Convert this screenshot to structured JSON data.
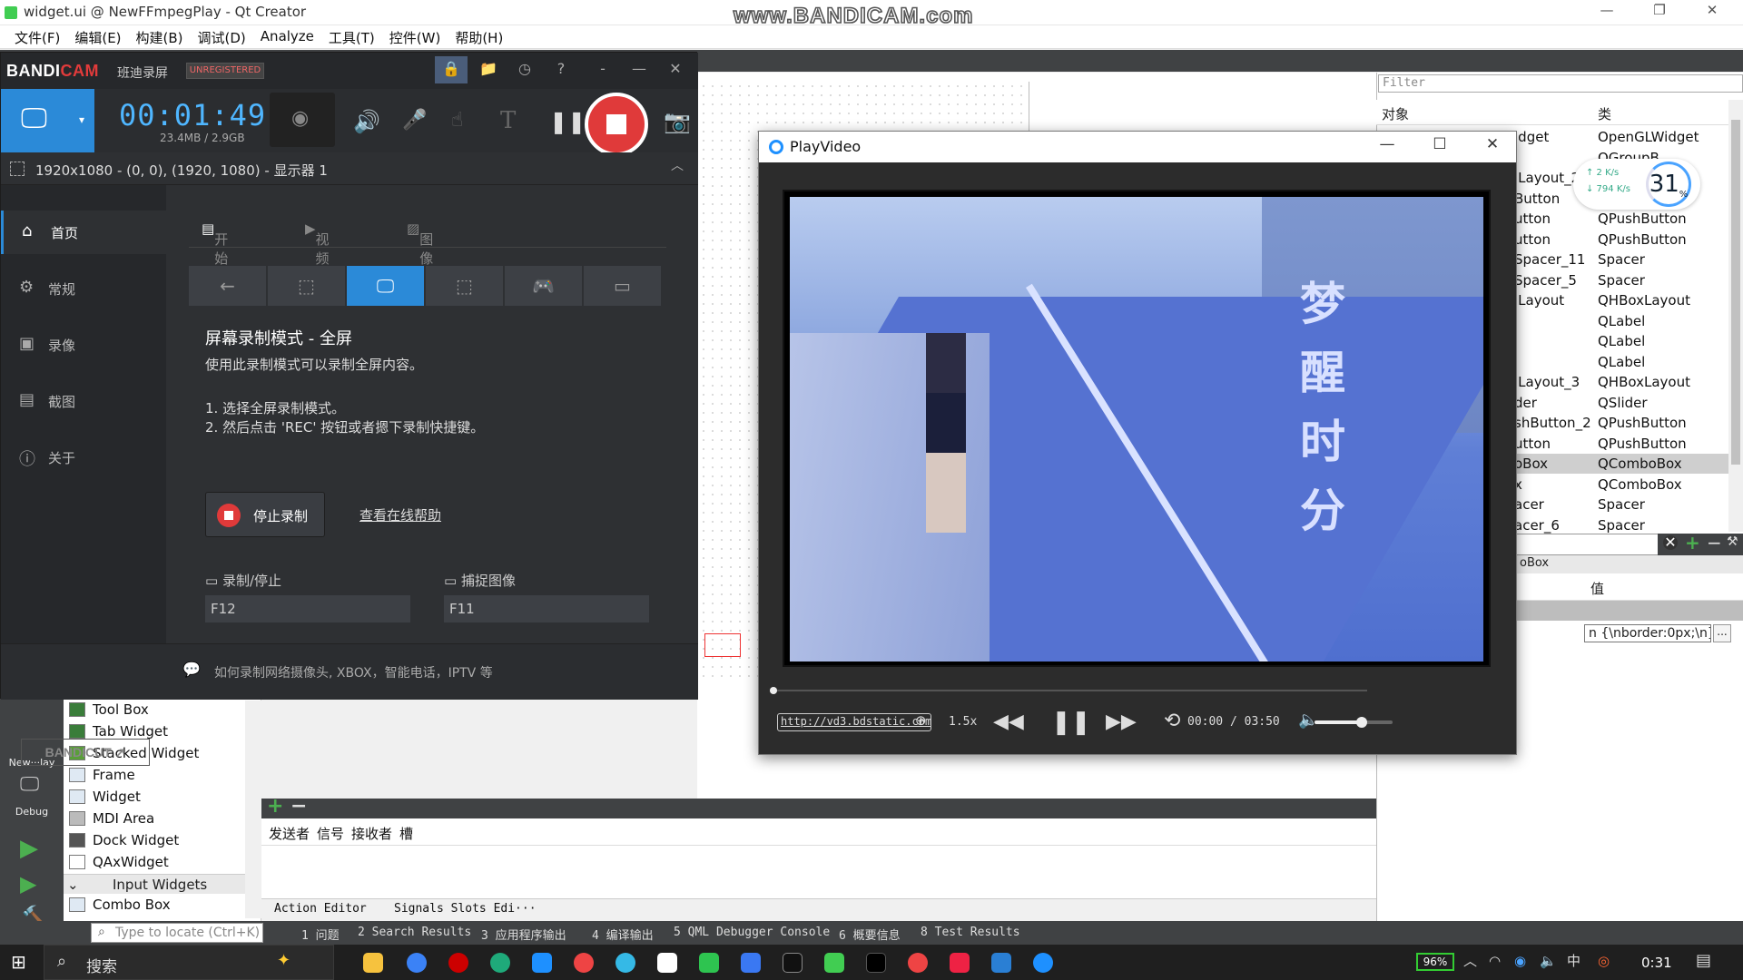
{
  "qt": {
    "title": "widget.ui @ NewFFmpegPlay - Qt Creator",
    "watermark": "www.BANDICAM.com",
    "menu": [
      "文件(F)",
      "编辑(E)",
      "构建(B)",
      "调试(D)",
      "Analyze",
      "工具(T)",
      "控件(W)",
      "帮助(H)"
    ],
    "mode_bar": {
      "project": "New···lay",
      "kit": "Debug"
    },
    "widget_box": {
      "items": [
        "Tool Box",
        "Tab Widget",
        "Stacked Widget",
        "Frame",
        "Widget",
        "MDI Area",
        "Dock Widget",
        "QAxWidget"
      ],
      "category": "Input Widgets",
      "after_category": "Combo Box"
    },
    "signal_slot": {
      "headers": [
        "发送者",
        "信号",
        "接收者",
        "槽"
      ],
      "tabs": [
        "Action Editor",
        "Signals Slots Edi···"
      ]
    },
    "output": {
      "locate_placeholder": "Type to locate (Ctrl+K)",
      "tabs": [
        "1 问题",
        "2 Search Results",
        "3 应用程序输出",
        "4 编译输出",
        "5 QML Debugger Console",
        "6 概要信息",
        "8 Test Results"
      ]
    },
    "object_inspector": {
      "filter_placeholder": "Filter",
      "col_object": "对象",
      "col_class": "类",
      "rows": [
        {
          "name": "idget",
          "cls": "OpenGLWidget"
        },
        {
          "name": "",
          "cls": "QGroupB"
        },
        {
          "name": "lLayout_2",
          "cls": "ut"
        },
        {
          "name": "Button",
          "cls": ""
        },
        {
          "name": "utton",
          "cls": "QPushButton"
        },
        {
          "name": "utton",
          "cls": "QPushButton"
        },
        {
          "name": "Spacer_11",
          "cls": "Spacer"
        },
        {
          "name": "Spacer_5",
          "cls": "Spacer"
        },
        {
          "name": "lLayout",
          "cls": "QHBoxLayout"
        },
        {
          "name": "",
          "cls": "QLabel"
        },
        {
          "name": "",
          "cls": "QLabel"
        },
        {
          "name": "",
          "cls": "QLabel"
        },
        {
          "name": "lLayout_3",
          "cls": "QHBoxLayout"
        },
        {
          "name": "der",
          "cls": "QSlider"
        },
        {
          "name": "shButton_2",
          "cls": "QPushButton"
        },
        {
          "name": "utton",
          "cls": "QPushButton"
        },
        {
          "name": "oBox",
          "cls": "QComboBox"
        },
        {
          "name": "x",
          "cls": "QComboBox"
        },
        {
          "name": "acer",
          "cls": "Spacer"
        },
        {
          "name": "acer_6",
          "cls": "Spacer"
        }
      ],
      "selected_row": 16
    },
    "property_editor": {
      "object_name": "oBox",
      "col_value": "值",
      "edit_value": "n {\\nborder:0px;\\n}",
      "more": "..."
    }
  },
  "speed_meter": {
    "up": "↑ 2 K/s",
    "down": "↓ 794 K/s",
    "percent": "31",
    "unit": "%"
  },
  "bandicam": {
    "logo_a": "BANDI",
    "logo_b": "CAM",
    "cn_name": "班迪录屏",
    "unregistered": "UNREGISTERED",
    "timer": "00:01:49",
    "size": "23.4MB / 2.9GB",
    "resolution": "1920x1080 - (0, 0), (1920, 1080) - 显示器 1",
    "nav": [
      "首页",
      "常规",
      "录像",
      "截图",
      "关于"
    ],
    "tabs": [
      "开始",
      "视频",
      "图像"
    ],
    "mode_title": "屏幕录制模式 - 全屏",
    "mode_desc": "使用此录制模式可以录制全屏内容。",
    "step1": "1. 选择全屏录制模式。",
    "step2": "2. 然后点击 'REC' 按钮或者摁下录制快捷键。",
    "stop_label": "停止录制",
    "help_link": "查看在线帮助",
    "hotkey_record_label": "录制/停止",
    "hotkey_record": "F12",
    "hotkey_capture_label": "捕捉图像",
    "hotkey_capture": "F11",
    "bandicut": "BANDICUT ↗",
    "footer": "如何录制网络摄像头, XBOX，智能电话，IPTV 等"
  },
  "player": {
    "title": "PlayVideo",
    "subtitle": [
      "梦",
      "醒",
      "时",
      "分"
    ],
    "url": "http://vd3.bdstatic.com",
    "speed": "1.5x",
    "time": "00:00 / 03:50",
    "progress": 0.0,
    "volume": 0.6
  },
  "taskbar": {
    "search": "搜索",
    "battery": "96%",
    "clock": "0:31"
  }
}
